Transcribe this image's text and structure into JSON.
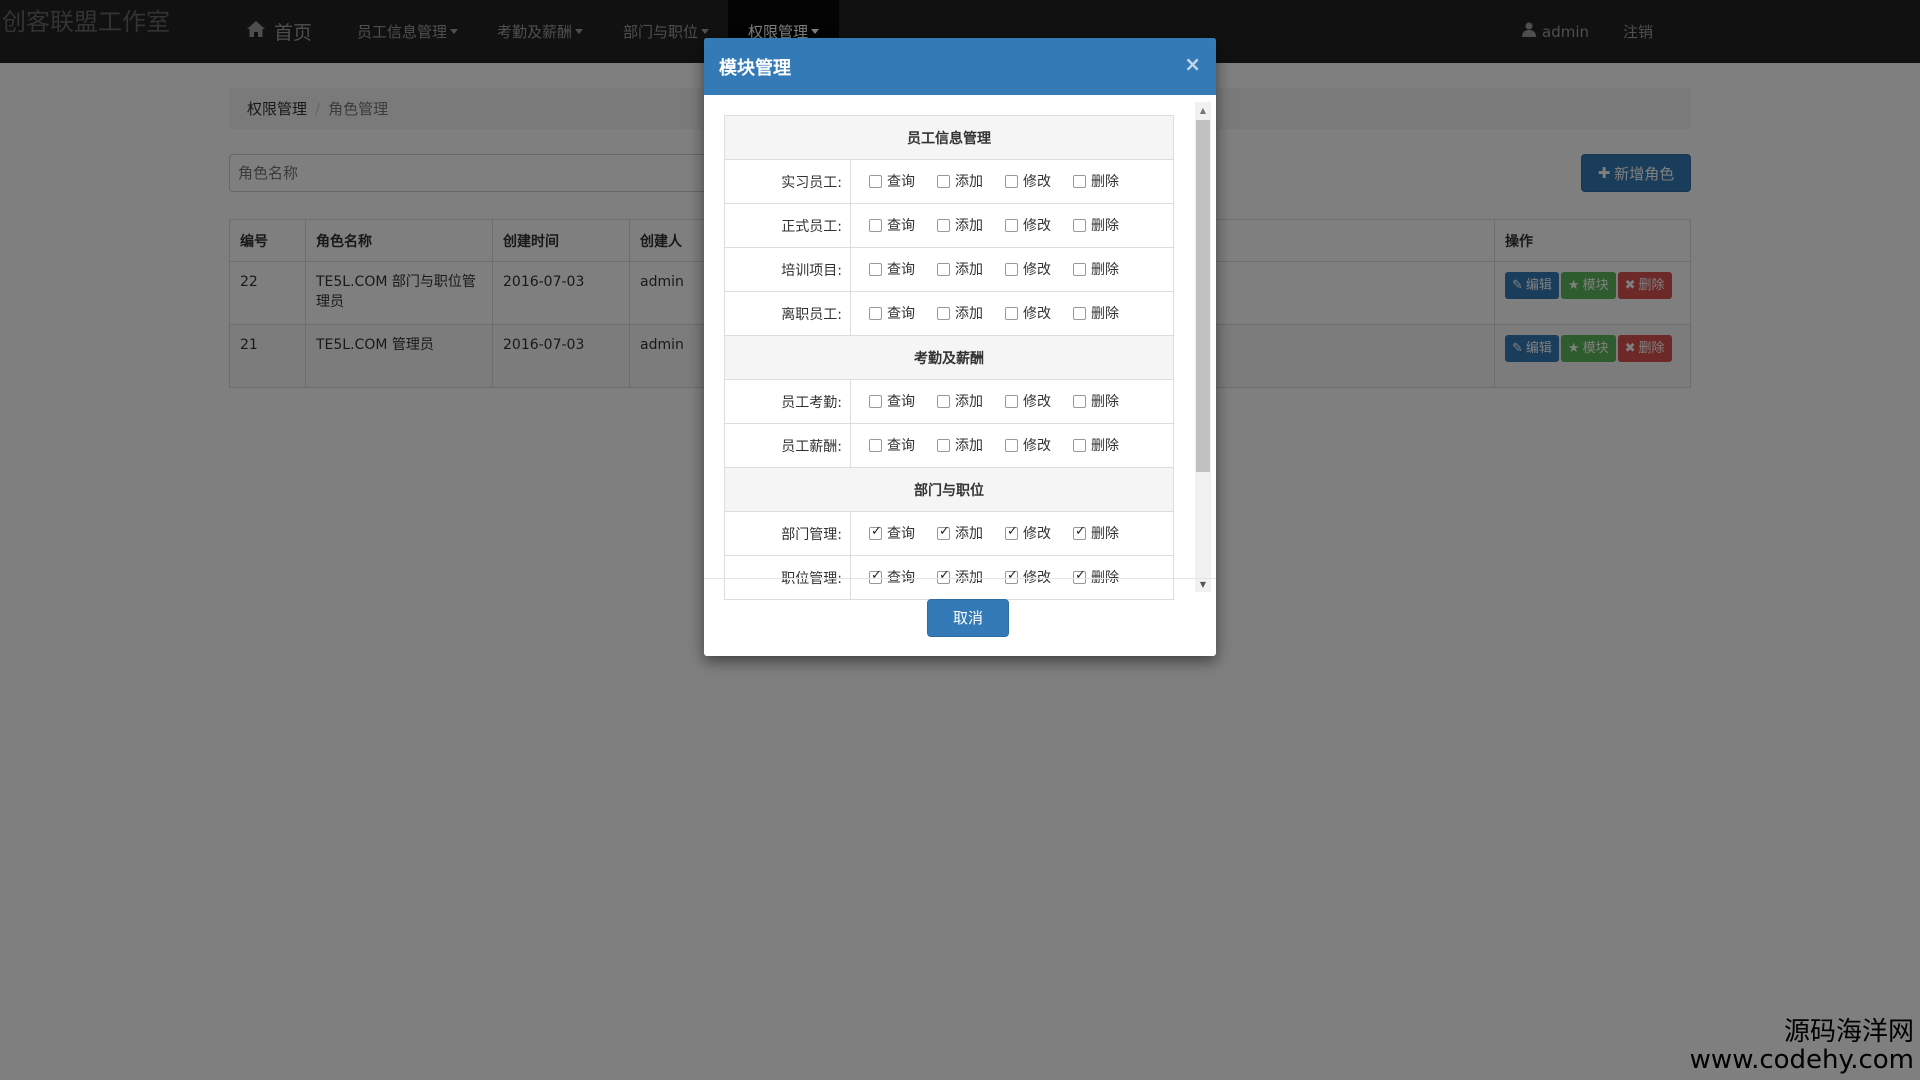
{
  "watermark": {
    "top_left": "创客联盟工作室",
    "bottom_cn": "源码海洋网",
    "bottom_url": "www.codehy.com"
  },
  "navbar": {
    "home": "首页",
    "items": [
      "员工信息管理",
      "考勤及薪酬",
      "部门与职位",
      "权限管理"
    ],
    "user": "admin",
    "logout": "注销"
  },
  "breadcrumb": {
    "parent": "权限管理",
    "current": "角色管理"
  },
  "search": {
    "placeholder": "角色名称"
  },
  "add_role_button": "新增角色",
  "table": {
    "headers": [
      "编号",
      "角色名称",
      "创建时间",
      "创建人",
      "",
      "操作"
    ],
    "rows": [
      {
        "id": "22",
        "name": "TE5L.COM 部门与职位管理员",
        "created": "2016-07-03",
        "creator": "admin"
      },
      {
        "id": "21",
        "name": "TE5L.COM 管理员",
        "created": "2016-07-03",
        "creator": "admin"
      }
    ],
    "actions": {
      "edit": "编辑",
      "module": "模块",
      "delete": "删除"
    }
  },
  "modal": {
    "title": "模块管理",
    "close": "×",
    "options": [
      "查询",
      "添加",
      "修改",
      "删除"
    ],
    "groups": [
      {
        "title": "员工信息管理",
        "rows": [
          {
            "label": "实习员工:",
            "checked": [
              false,
              false,
              false,
              false
            ]
          },
          {
            "label": "正式员工:",
            "checked": [
              false,
              false,
              false,
              false
            ]
          },
          {
            "label": "培训项目:",
            "checked": [
              false,
              false,
              false,
              false
            ]
          },
          {
            "label": "离职员工:",
            "checked": [
              false,
              false,
              false,
              false
            ]
          }
        ]
      },
      {
        "title": "考勤及薪酬",
        "rows": [
          {
            "label": "员工考勤:",
            "checked": [
              false,
              false,
              false,
              false
            ]
          },
          {
            "label": "员工薪酬:",
            "checked": [
              false,
              false,
              false,
              false
            ]
          }
        ]
      },
      {
        "title": "部门与职位",
        "rows": [
          {
            "label": "部门管理:",
            "checked": [
              true,
              true,
              true,
              true
            ]
          },
          {
            "label": "职位管理:",
            "checked": [
              true,
              true,
              true,
              true
            ]
          }
        ]
      }
    ],
    "cancel": "取消"
  }
}
